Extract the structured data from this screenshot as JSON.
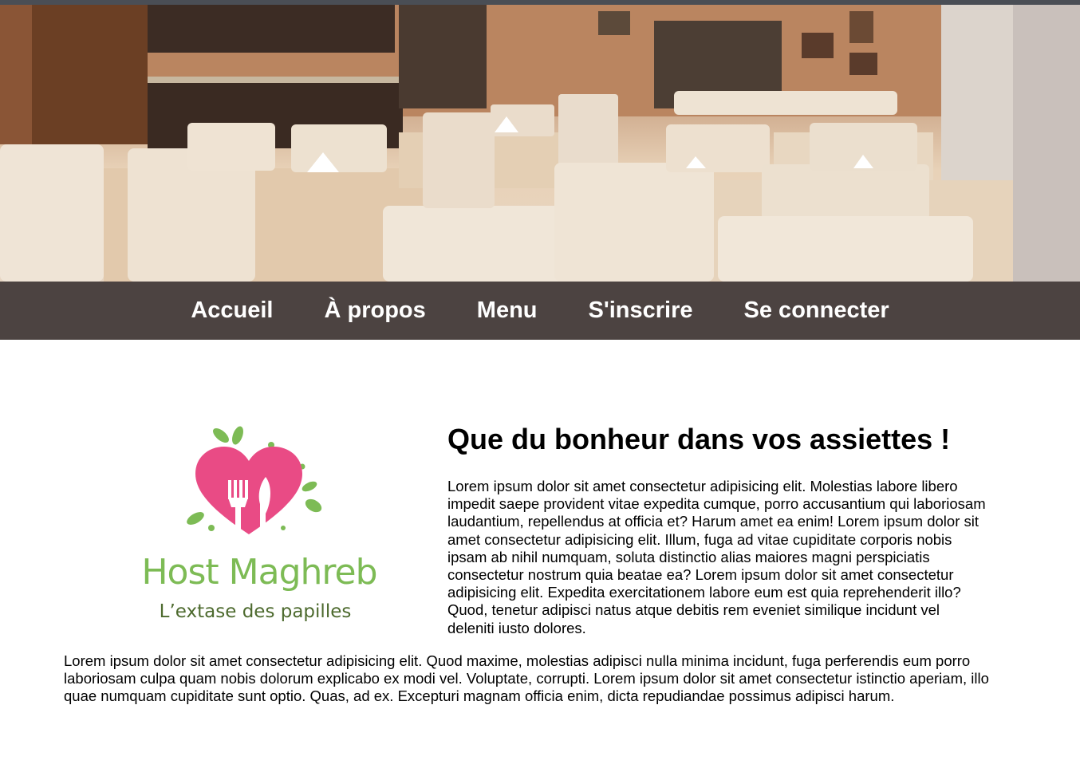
{
  "hero": {
    "image": "restaurant-dining-room-photo"
  },
  "nav": {
    "items": [
      "Accueil",
      "À propos",
      "Menu",
      "S'inscrire",
      "Se connecter"
    ]
  },
  "logo": {
    "icon": "heart-fork-knife-icon",
    "brand": "Host Maghreb",
    "tagline": "L’extase des papilles",
    "colors": {
      "heart": "#e94b85",
      "leaves": "#7dbb55",
      "tagline": "#4d6a2e"
    }
  },
  "content": {
    "title": "Que du bonheur dans vos assiettes !",
    "intro": "Lorem ipsum dolor sit amet consectetur adipisicing elit. Molestias labore libero impedit saepe provident vitae expedita cumque, porro accusantium qui laboriosam laudantium, repellendus at officia et? Harum amet ea enim! Lorem ipsum dolor sit amet consectetur adipisicing elit. Illum, fuga ad vitae cupiditate corporis nobis ipsam ab nihil numquam, soluta distinctio alias maiores magni perspiciatis consectetur nostrum quia beatae ea? Lorem ipsum dolor sit amet consectetur adipisicing elit. Expedita exercitationem labore eum est quia reprehenderit illo? Quod, tenetur adipisci natus atque debitis rem eveniet similique incidunt vel deleniti iusto dolores.",
    "body": "Lorem ipsum dolor sit amet consectetur adipisicing elit. Quod maxime, molestias adipisci nulla minima incidunt, fuga perferendis eum porro laboriosam culpa quam nobis dolorum explicabo ex modi vel. Voluptate, corrupti. Lorem ipsum dolor sit amet consectetur istinctio aperiam, illo quae numquam cupiditate sunt optio. Quas, ad ex. Excepturi magnam officia enim, dicta repudiandae possimus adipisci harum."
  },
  "colors": {
    "nav_bg": "#4c4341",
    "nav_text": "#ffffff",
    "page_bg": "#ffffff"
  }
}
